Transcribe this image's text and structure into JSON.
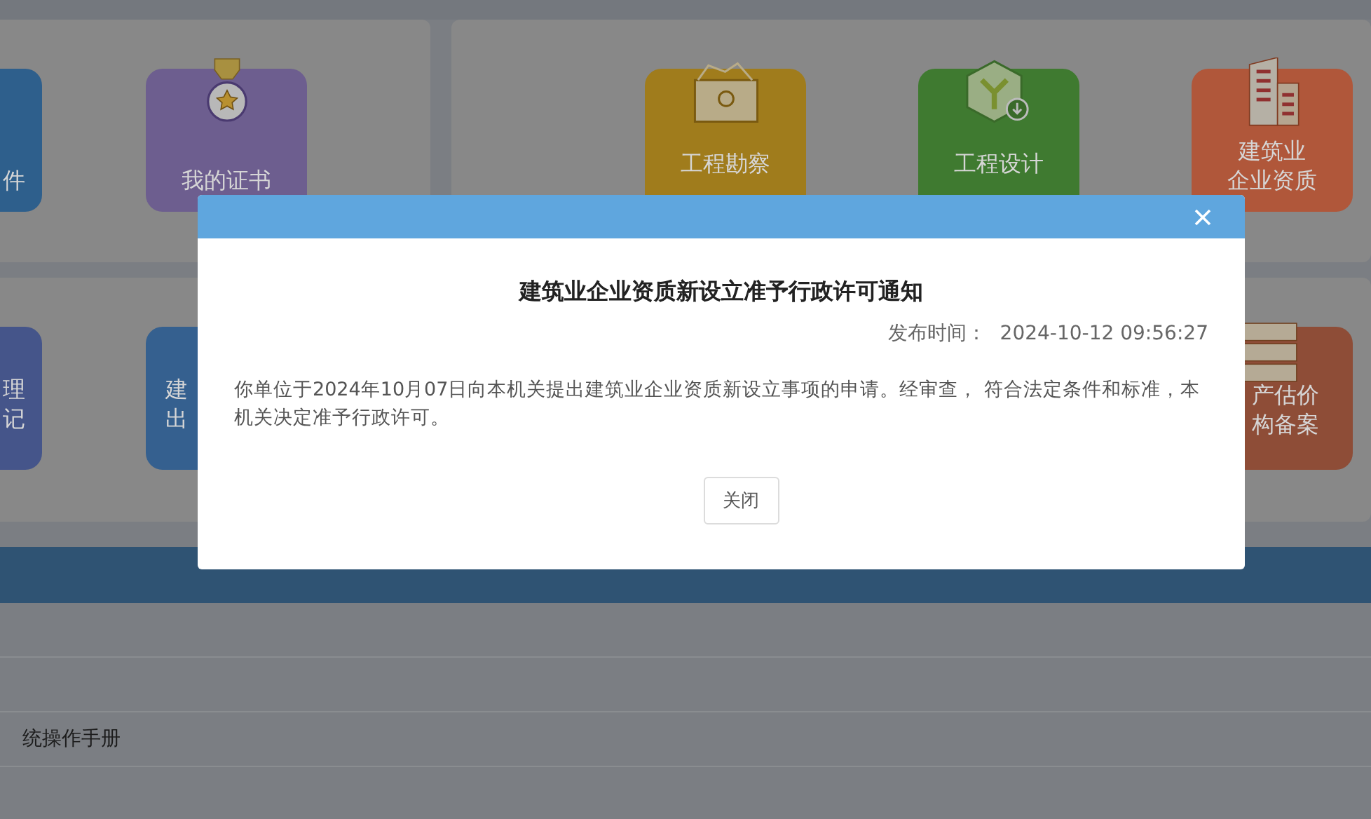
{
  "panels": [
    {
      "tiles": [
        {
          "kind": "none",
          "color": "#2e5f8c",
          "lines": [
            "件"
          ]
        },
        {
          "kind": "medal",
          "color": "#6d5e8f",
          "lines": [
            "我的证书"
          ]
        }
      ]
    },
    {
      "tiles": [
        {
          "kind": "box",
          "color": "#a07c1c",
          "lines": [
            "工程勘察"
          ]
        },
        {
          "kind": "cube",
          "color": "#3f7a30",
          "lines": [
            "工程设计"
          ]
        },
        {
          "kind": "building",
          "color": "#b0573a",
          "lines": [
            "建筑业",
            "企业资质"
          ]
        }
      ]
    },
    {
      "tiles": [
        {
          "kind": "none",
          "color": "#45558a",
          "lines": [
            "理",
            "记"
          ]
        },
        {
          "kind": "none",
          "color": "#35608f",
          "lines": [
            "建",
            "出"
          ]
        }
      ]
    },
    {
      "tiles": [
        {
          "kind": "drawers",
          "color": "#8e4d37",
          "lines": [
            "产估价",
            "构备案"
          ]
        }
      ]
    }
  ],
  "list": {
    "items": [
      "统操作手册"
    ]
  },
  "dialog": {
    "title": "建筑业企业资质新设立准予行政许可通知",
    "publish_label": "发布时间：",
    "publish_time": "2024-10-12 09:56:27",
    "body": "你单位于2024年10月07日向本机关提出建筑业企业资质新设立事项的申请。经审查， 符合法定条件和标准，本机关决定准予行政许可。",
    "buttons": [
      "关闭"
    ]
  }
}
